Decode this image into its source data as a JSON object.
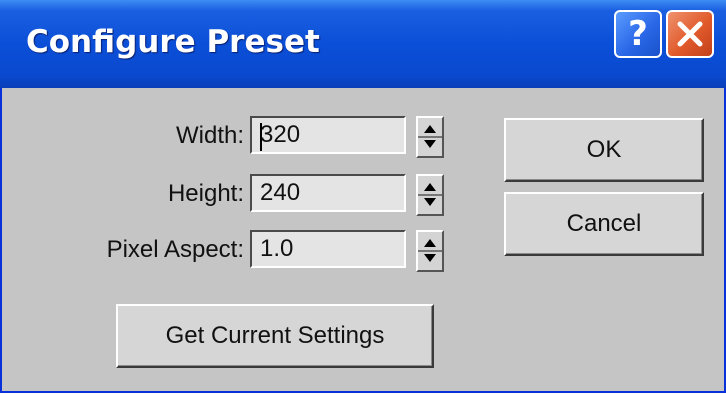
{
  "window": {
    "title": "Configure Preset",
    "help_glyph": "?",
    "close_icon": "close-x-icon",
    "help_icon": "question-mark-icon"
  },
  "fields": [
    {
      "label": "Width:",
      "value": "320"
    },
    {
      "label": "Height:",
      "value": "240"
    },
    {
      "label": "Pixel Aspect:",
      "value": "1.0"
    }
  ],
  "buttons": {
    "ok": "OK",
    "cancel": "Cancel",
    "get_current_settings": "Get Current Settings"
  },
  "colors": {
    "titlebar": "#0b4fd8",
    "close_button": "#e05a2b",
    "body": "#c5c5c5"
  }
}
